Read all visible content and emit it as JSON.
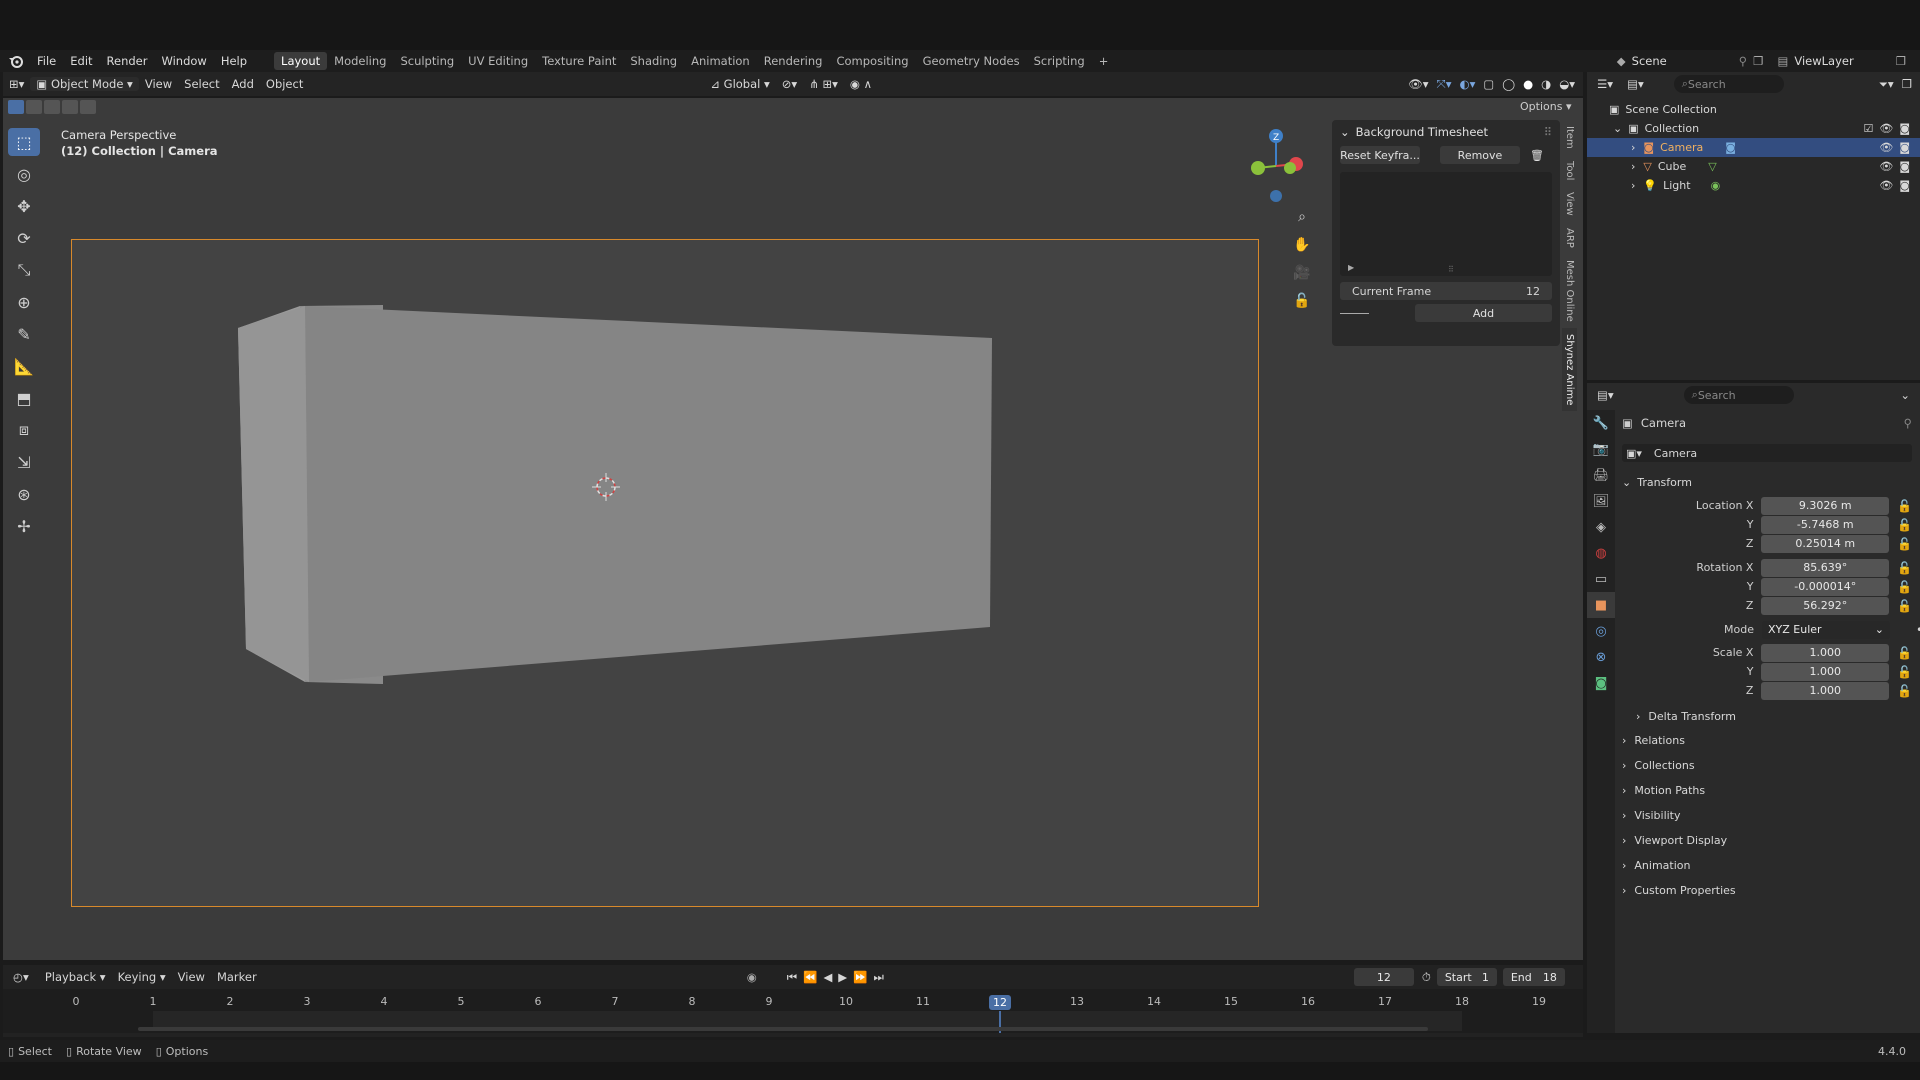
{
  "menu": {
    "items": [
      "File",
      "Edit",
      "Render",
      "Window",
      "Help"
    ],
    "workspaces": [
      "Layout",
      "Modeling",
      "Sculpting",
      "UV Editing",
      "Texture Paint",
      "Shading",
      "Animation",
      "Rendering",
      "Compositing",
      "Geometry Nodes",
      "Scripting"
    ],
    "active_workspace": "Layout",
    "add_tab": "+",
    "scene_label": "Scene",
    "viewlayer_label": "ViewLayer"
  },
  "viewport_header": {
    "mode": "Object Mode",
    "menus": [
      "View",
      "Select",
      "Add",
      "Object"
    ],
    "orientation": "Global",
    "options": "Options"
  },
  "viewport": {
    "line1": "Camera Perspective",
    "line2": "(12) Collection | Camera"
  },
  "npanel": {
    "title": "Background Timesheet",
    "reset_btn": "Reset Keyfra...",
    "remove_btn": "Remove",
    "current_frame_label": "Current Frame",
    "current_frame_value": "12",
    "add_btn": "Add"
  },
  "side_tabs": [
    "Item",
    "Tool",
    "View",
    "ARP",
    "Mesh Online",
    "Shynez Anime"
  ],
  "outliner": {
    "search_placeholder": "Search",
    "scene_collection": "Scene Collection",
    "collection": "Collection",
    "items": [
      "Camera",
      "Cube",
      "Light"
    ]
  },
  "properties": {
    "search_placeholder": "Search",
    "object_name": "Camera",
    "data_name": "Camera",
    "transform_label": "Transform",
    "location_label": "Location X",
    "location": [
      "9.3026 m",
      "-5.7468 m",
      "0.25014 m"
    ],
    "rotation_label": "Rotation X",
    "rotation": [
      "85.639°",
      "-0.000014°",
      "56.292°"
    ],
    "mode_label": "Mode",
    "mode_value": "XYZ Euler",
    "scale_label": "Scale X",
    "scale": [
      "1.000",
      "1.000",
      "1.000"
    ],
    "axis_y": "Y",
    "axis_z": "Z",
    "delta": "Delta Transform",
    "sections": [
      "Relations",
      "Collections",
      "Motion Paths",
      "Visibility",
      "Viewport Display",
      "Animation",
      "Custom Properties"
    ]
  },
  "timeline": {
    "menus": [
      "Playback",
      "Keying",
      "View",
      "Marker"
    ],
    "current_frame": "12",
    "start_label": "Start",
    "start_value": "1",
    "end_label": "End",
    "end_value": "18",
    "ruler": [
      "0",
      "1",
      "2",
      "3",
      "4",
      "5",
      "6",
      "7",
      "8",
      "9",
      "10",
      "11",
      "12",
      "13",
      "14",
      "15",
      "16",
      "17",
      "18",
      "19"
    ],
    "current_index": 12
  },
  "statusbar": {
    "select": "Select",
    "rotate": "Rotate View",
    "options": "Options",
    "version": "4.4.0"
  },
  "colors": {
    "accent": "#4a6fa5",
    "selection": "#334d80",
    "camera_frame": "#d8892b",
    "x_axis": "#e0474c",
    "y_axis": "#8bc13b",
    "z_axis": "#3f80c8"
  }
}
